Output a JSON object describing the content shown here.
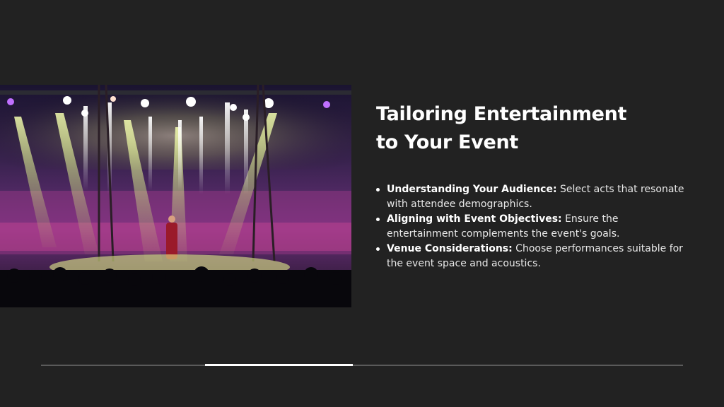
{
  "slide": {
    "title_line1": "Tailoring Entertainment",
    "title_line2": "to Your Event",
    "bullets": [
      {
        "label": "Understanding Your Audience:",
        "text": " Select acts that resonate with attendee demographics."
      },
      {
        "label": "Aligning with Event Objectives:",
        "text": " Ensure the entertainment complements the event's goals."
      },
      {
        "label": "Venue Considerations:",
        "text": " Choose performances suitable for the event space and acoustics."
      }
    ]
  },
  "progress": {
    "fraction": 0.23
  },
  "colors": {
    "background": "#222222",
    "text": "#ffffff",
    "track": "#5a5a5a"
  }
}
